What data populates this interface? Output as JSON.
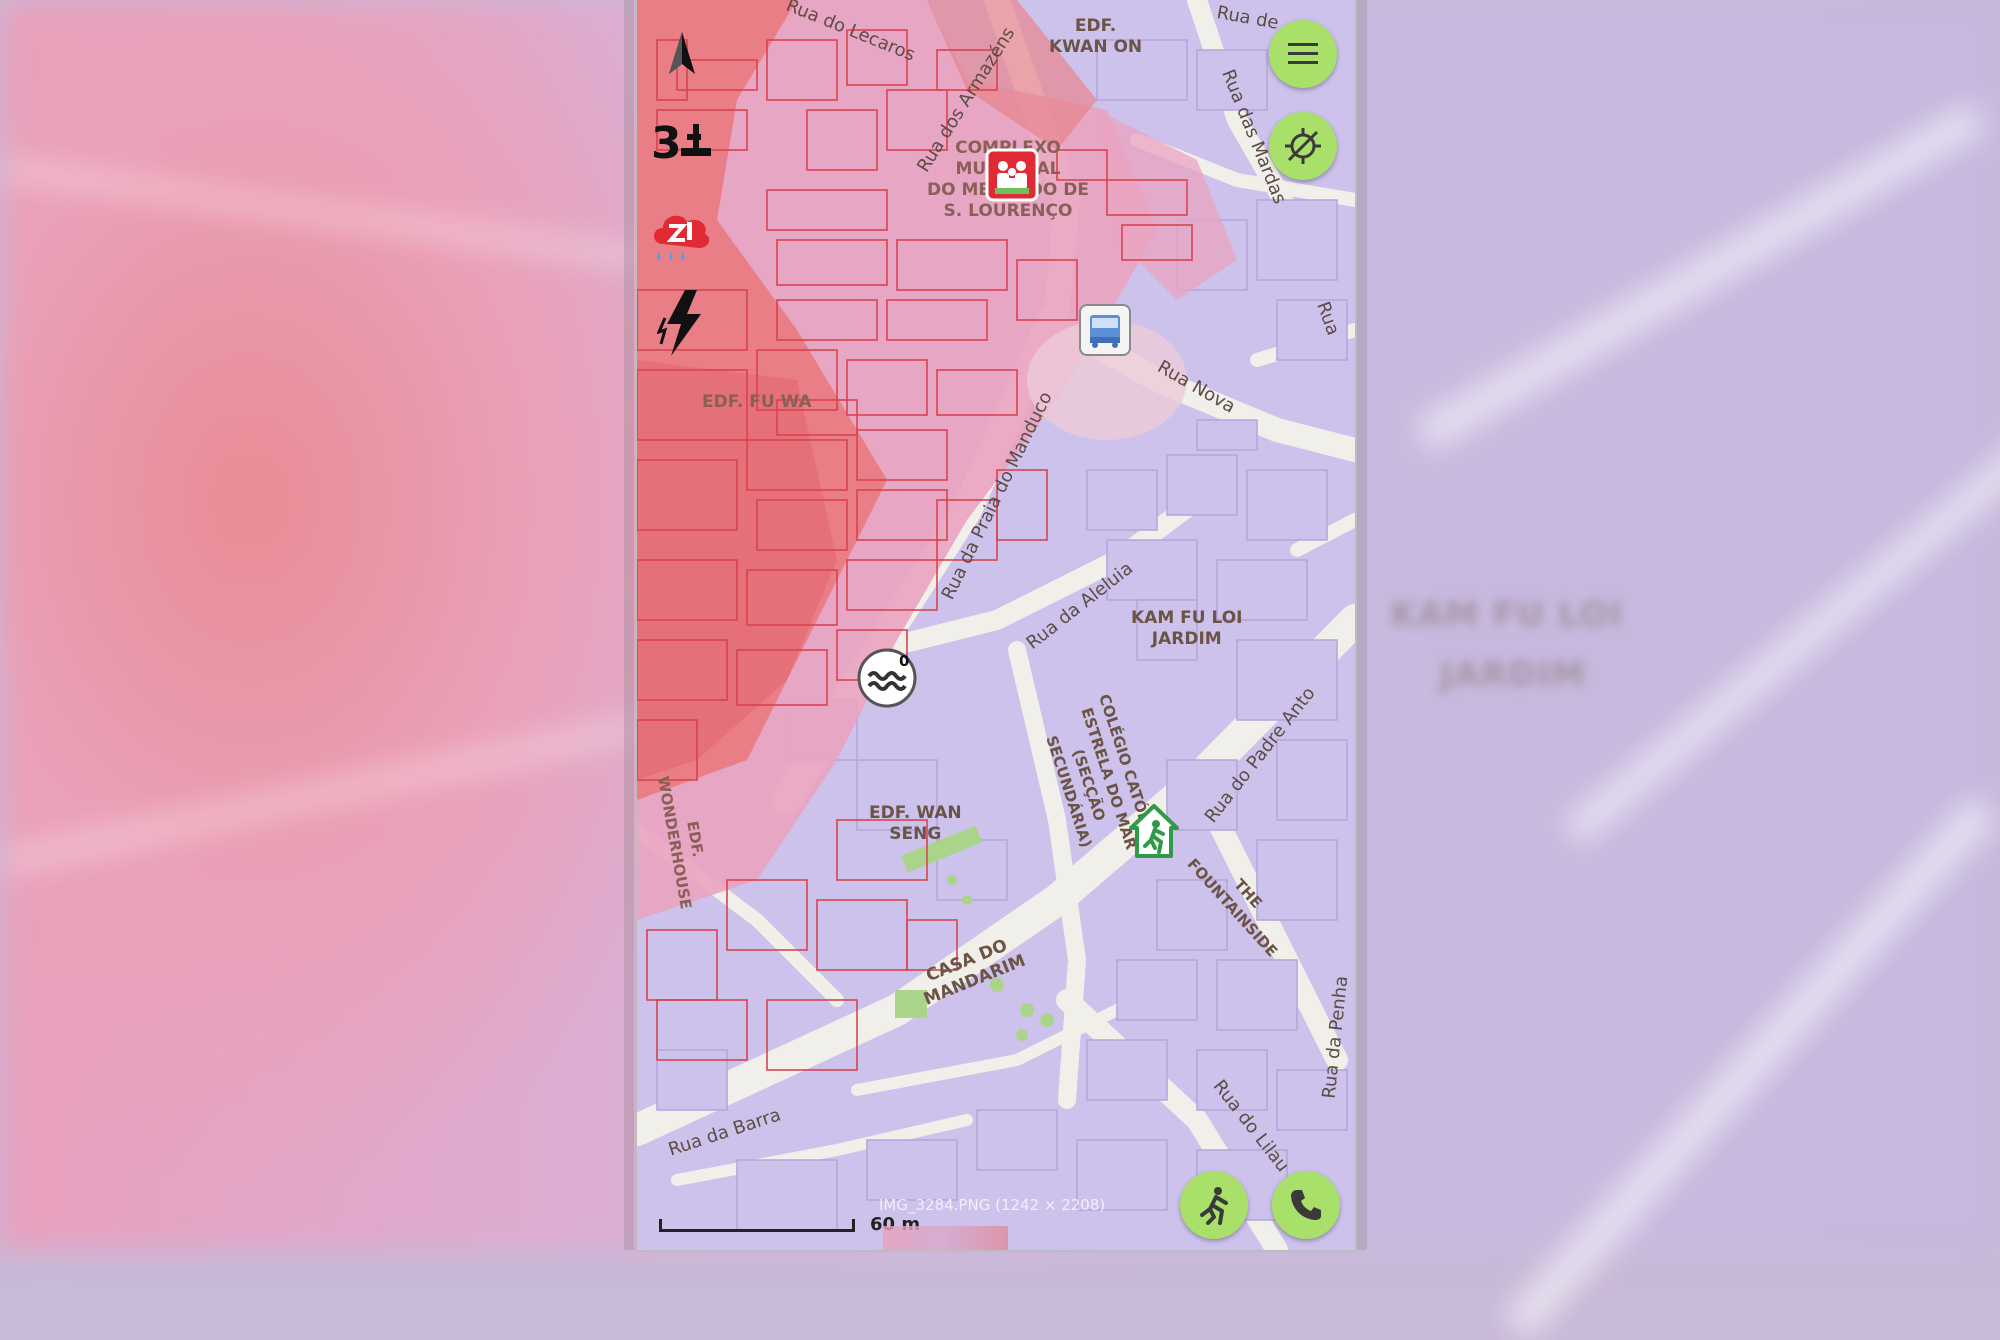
{
  "map": {
    "place_labels": [
      {
        "id": "edf-kwan-on",
        "text": "EDF.\nKWAN ON"
      },
      {
        "id": "complexo",
        "text": "COMPLEXO\nMUNICIPAL\nDO MERCADO DE\nS. LOURENÇO"
      },
      {
        "id": "edf-fu-wa",
        "text": "EDF. FU WA"
      },
      {
        "id": "kam-fu-loi",
        "text": "KAM FU LOI\nJARDIM"
      },
      {
        "id": "colegio",
        "text": "COLÉGIO CATÓLICO\nESTRELA DO MAR\n(SECÇÃO\nSECUNDÁRIA)"
      },
      {
        "id": "edf-wan-seng",
        "text": "EDF. WAN\nSENG"
      },
      {
        "id": "edf-wonderhouse",
        "text": "EDF.\nWONDERHOUSE"
      },
      {
        "id": "casa-mandarim",
        "text": "CASA DO\nMANDARIM"
      },
      {
        "id": "the-fountainside",
        "text": "THE\nFOUNTAINSIDE"
      }
    ],
    "street_labels": [
      {
        "id": "rua-lecaros",
        "text": "Rua do Lecaros"
      },
      {
        "id": "rua-armazens",
        "text": "Rua dos Armazéns"
      },
      {
        "id": "rua-de-cima",
        "text": "Rua de"
      },
      {
        "id": "rua-das-mardas",
        "text": "Rua das Mardas"
      },
      {
        "id": "rua-nova",
        "text": "Rua Nova"
      },
      {
        "id": "rua-right",
        "text": "Rua"
      },
      {
        "id": "rua-praia-manduco",
        "text": "Rua da Praia do Manduco"
      },
      {
        "id": "rua-aleluia",
        "text": "Rua da Aleluia"
      },
      {
        "id": "rua-padre-anto",
        "text": "Rua do Padre Anto"
      },
      {
        "id": "rua-penha",
        "text": "Rua da Penha"
      },
      {
        "id": "rua-lilau",
        "text": "Rua do Lilau"
      },
      {
        "id": "rua-barra",
        "text": "Rua da Barra"
      }
    ],
    "scale_label": "60 m",
    "file_caption": "IMG_3284.PNG (1242 × 2208)"
  },
  "hud": {
    "level_number": "3",
    "flood_badge_value": "0"
  },
  "buttons": {
    "menu": "menu-icon",
    "location": "location-off-icon",
    "evacuate": "running-person-icon",
    "call": "phone-icon"
  },
  "colors": {
    "accent_button": "#a9e06a",
    "flood_red": "#e9737a",
    "flood_pink": "#eaa3c0",
    "building_violet": "#cdc2ec",
    "road": "#f0ede6",
    "park": "#9fcf7f"
  }
}
